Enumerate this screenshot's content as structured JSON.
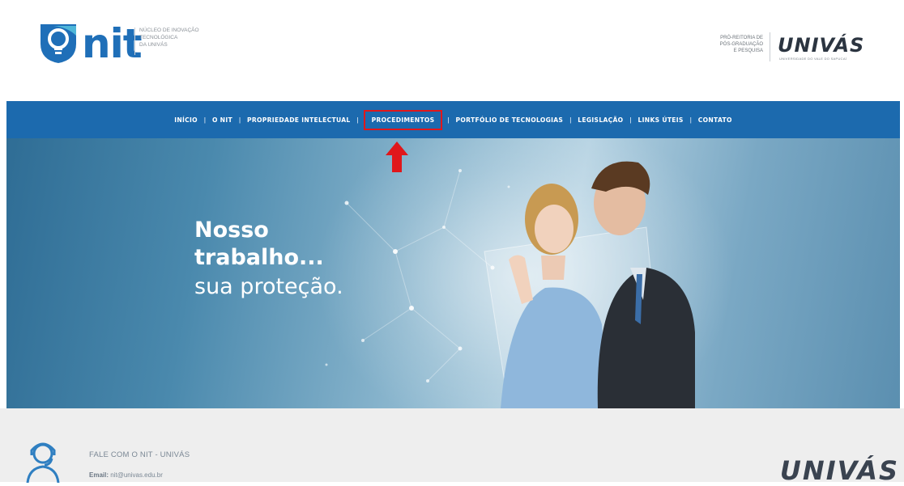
{
  "header": {
    "logo_word": "nit",
    "logo_tagline": "Núcleo de Inovação\nTecnológica\nda Univás",
    "pro_reitoria": "Pró-Reitoria de\nPós-Graduação\ne Pesquisa",
    "univas_text": "UNIVÁS",
    "univas_sub": "Universidade do Vale do Sapucaí"
  },
  "nav": {
    "items": [
      {
        "label": "Início"
      },
      {
        "label": "O NIT"
      },
      {
        "label": "Propriedade Intelectual"
      },
      {
        "label": "Procedimentos"
      },
      {
        "label": "Portfólio de Tecnologias"
      },
      {
        "label": "Legislação"
      },
      {
        "label": "Links Úteis"
      },
      {
        "label": "Contato"
      }
    ],
    "separator": "|",
    "highlight_color": "#e0171b"
  },
  "hero": {
    "title_line1": "Nosso",
    "title_line2": "trabalho...",
    "subtitle": "sua proteção."
  },
  "footer": {
    "heading": "Fale com o NIT - Univás",
    "email_label": "Email:",
    "email_value": "nit@univas.edu.br",
    "univas_text": "UNIVÁS"
  },
  "colors": {
    "nav_bg": "#1c6aae",
    "brand_blue": "#1f6fb8",
    "annotation_red": "#e0171b"
  }
}
